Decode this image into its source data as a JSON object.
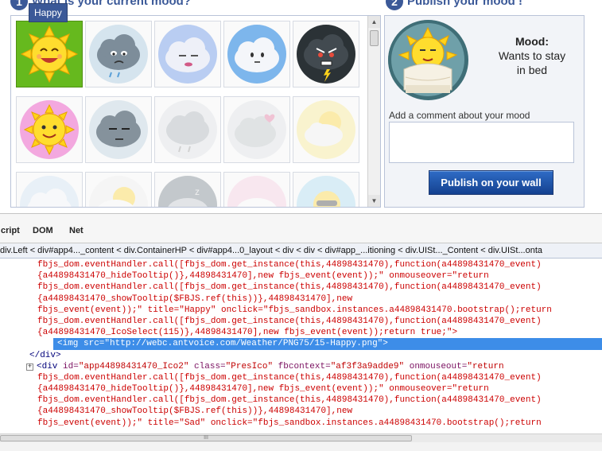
{
  "app": {
    "step1": {
      "num": "1",
      "title": "What is your current mood?"
    },
    "step2": {
      "num": "2",
      "title": "Publish your mood !"
    },
    "tooltip": "Happy",
    "selected_mood": {
      "label": "Mood:",
      "text": "Wants to stay in bed"
    },
    "comment_label": "Add a comment about your mood",
    "comment_value": "",
    "publish_label": "Publish on your wall",
    "moods": [
      {
        "name": "happy",
        "icon": "happy-sun-icon",
        "selected": true
      },
      {
        "name": "sad",
        "icon": "sad-cloud-icon"
      },
      {
        "name": "sleepy",
        "icon": "sleepy-cloud-icon"
      },
      {
        "name": "calm",
        "icon": "calm-cloud-icon"
      },
      {
        "name": "angry",
        "icon": "angry-storm-icon"
      },
      {
        "name": "love",
        "icon": "love-sun-icon"
      },
      {
        "name": "tired",
        "icon": "tired-cloud-icon"
      },
      {
        "name": "faded-rain",
        "icon": "rain-cloud-icon",
        "faded": true
      },
      {
        "name": "faded-heart",
        "icon": "heart-cloud-icon",
        "faded": true
      },
      {
        "name": "faded-partly",
        "icon": "partly-sunny-icon",
        "faded": true
      },
      {
        "name": "faded-cloud",
        "icon": "cloud-icon",
        "faded": true
      },
      {
        "name": "faded-sun",
        "icon": "sun-cloud-icon",
        "faded": true
      },
      {
        "name": "faded-zzz",
        "icon": "sleep-cloud-icon",
        "faded": true
      },
      {
        "name": "faded-pink",
        "icon": "pink-cloud-icon",
        "faded": true
      },
      {
        "name": "faded-cool",
        "icon": "cool-sun-icon",
        "faded": true
      }
    ]
  },
  "devtools": {
    "tabs": [
      "cript",
      "DOM",
      "Net"
    ],
    "breadcrumb": "div.Left < div#app4..._content < div.ContainerHP < div#app4...0_layout < div < div < div#app_...itioning < div.UISt..._Content < div.UISt...onta",
    "lines": [
      "fbjs_dom.eventHandler.call([fbjs_dom.get_instance(this,44898431470),function(a44898431470_event)",
      "{a44898431470_hideTooltip()},44898431470],new fbjs_event(event));\" onmouseover=\"return",
      "fbjs_dom.eventHandler.call([fbjs_dom.get_instance(this,44898431470),function(a44898431470_event)",
      "{a44898431470_showTooltip($FBJS.ref(this))},44898431470],new",
      "fbjs_event(event));\" title=\"Happy\" onclick=\"fbjs_sandbox.instances.a44898431470.bootstrap();return",
      "fbjs_dom.eventHandler.call([fbjs_dom.get_instance(this,44898431470),function(a44898431470_event)",
      "{a44898431470_IcoSelect(115)},44898431470],new fbjs_event(event));return true;\">"
    ],
    "img_line": "<img src=\"http://webc.antvoice.com/Weather/PNG75/15-Happy.png\">",
    "close_div": "</div>",
    "div_open": {
      "expander": "+",
      "tag": "<div",
      "id_attr": " id=",
      "id_val": "\"app44898431470_Ico2\"",
      "class_attr": " class=",
      "class_val": "\"PresIco\"",
      "ctx_attr": " fbcontext=",
      "ctx_val": "\"af3f3a9adde9\"",
      "out_attr": " onmouseout=",
      "out_val": "\"return"
    },
    "lines2": [
      "fbjs_dom.eventHandler.call([fbjs_dom.get_instance(this,44898431470),function(a44898431470_event)",
      "{a44898431470_hideTooltip()},44898431470],new fbjs_event(event));\" onmouseover=\"return",
      "fbjs_dom.eventHandler.call([fbjs_dom.get_instance(this,44898431470),function(a44898431470_event)",
      "{a44898431470_showTooltip($FBJS.ref(this))},44898431470],new",
      "fbjs_event(event));\" title=\"Sad\" onclick=\"fbjs_sandbox.instances.a44898431470.bootstrap();return"
    ],
    "scroll_grip": "III"
  }
}
